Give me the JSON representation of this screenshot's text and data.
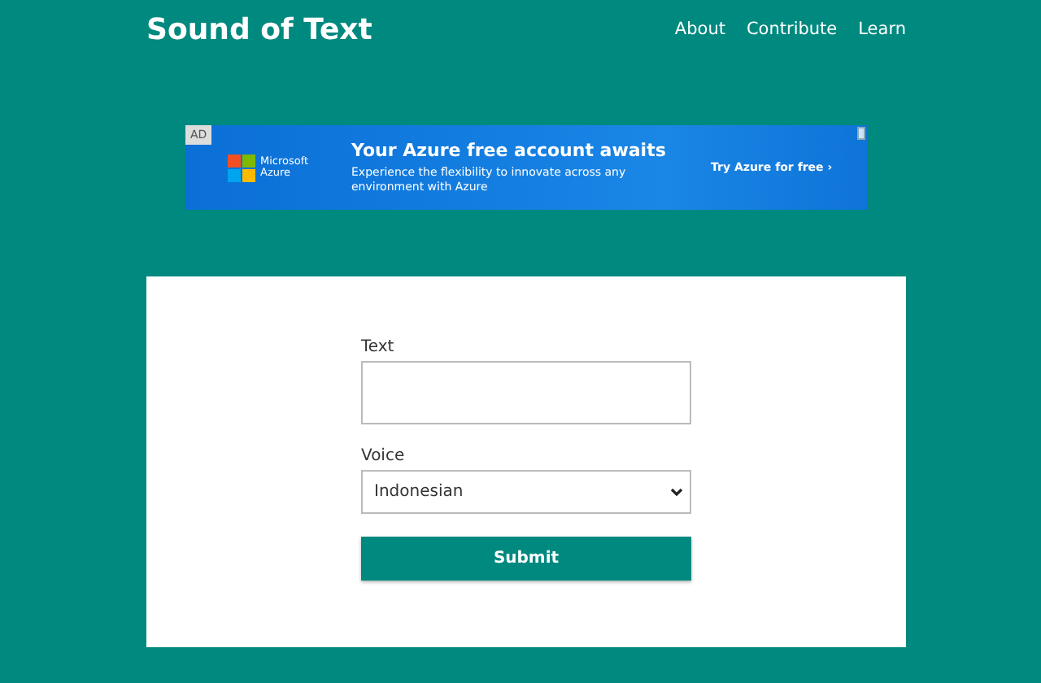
{
  "header": {
    "title": "Sound of Text",
    "nav": [
      "About",
      "Contribute",
      "Learn"
    ]
  },
  "ad": {
    "badge": "AD",
    "brand": [
      "Microsoft",
      "Azure"
    ],
    "headline": "Your Azure free account awaits",
    "body": "Experience the flexibility to innovate across any environment with Azure",
    "cta": "Try Azure for free ›"
  },
  "form": {
    "text_label": "Text",
    "voice_label": "Voice",
    "voice_value": "Indonesian",
    "submit": "Submit"
  }
}
